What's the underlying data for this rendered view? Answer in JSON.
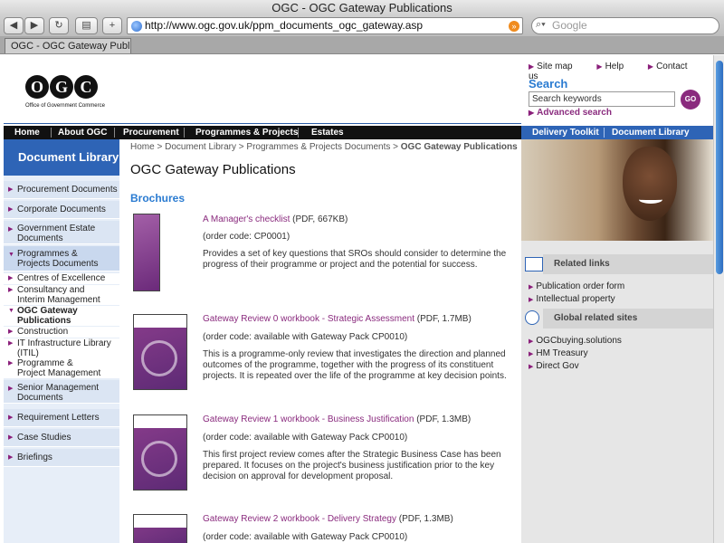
{
  "window": {
    "title": "OGC - OGC Gateway Publications"
  },
  "browser": {
    "back_label": "◀",
    "forward_label": "▶",
    "reload_label": "↻",
    "add_label": "+",
    "url": "http://www.ogc.gov.uk/ppm_documents_ogc_gateway.asp",
    "search_placeholder": "Google",
    "tab_label": "OGC - OGC Gateway Public..."
  },
  "header": {
    "logo_letters": [
      "O",
      "G",
      "C"
    ],
    "logo_tagline": "Office of Government Commerce",
    "util_links": [
      "Site map",
      "Help",
      "Contact us"
    ],
    "search_title": "Search",
    "search_placeholder": "Search keywords",
    "go_label": "GO",
    "advanced_search": "Advanced search"
  },
  "main_nav": [
    "Home",
    "About OGC",
    "Procurement",
    "Programmes & Projects",
    "Estates"
  ],
  "side_nav": [
    "Delivery Toolkit",
    "Document Library"
  ],
  "left_nav": {
    "title": "Document Library",
    "items": [
      "Procurement Documents",
      "Corporate Documents",
      "Government Estate Documents",
      "Programmes & Projects Documents",
      "Centres of Excellence",
      "Consultancy and Interim Management Support",
      "OGC Gateway Publications",
      "Construction",
      "IT Infrastructure Library (ITIL)",
      "Programme & Project Management",
      "Senior Management Documents",
      "Requirement Letters",
      "Case Studies",
      "Briefings"
    ]
  },
  "breadcrumb": {
    "items": [
      "Home",
      "Document Library",
      "Programmes & Projects Documents"
    ],
    "current": "OGC Gateway Publications"
  },
  "page": {
    "title": "OGC Gateway Publications",
    "section": "Brochures"
  },
  "publications": [
    {
      "link": "A Manager's checklist",
      "meta": " (PDF, 667KB)",
      "code": "(order code: CP0001)",
      "desc": "Provides a set of key questions that SROs should consider to determine the progress of their programme or project and the potential for success."
    },
    {
      "link": "Gateway Review 0 workbook - Strategic Assessment",
      "meta": " (PDF, 1.7MB)",
      "code": "(order code: available with Gateway Pack CP0010)",
      "desc": "This is a programme-only review that investigates the direction and planned outcomes of the programme, together with the progress of its constituent projects. It is repeated over the life of the programme at key decision points."
    },
    {
      "link": "Gateway Review 1 workbook - Business Justification",
      "meta": " (PDF, 1.3MB)",
      "code": "(order code: available with Gateway Pack CP0010)",
      "desc": "This first project review comes after the Strategic Business Case has been prepared. It focuses on the project's business justification prior to the key decision on approval for development proposal."
    },
    {
      "link": "Gateway Review 2 workbook - Delivery Strategy",
      "meta": " (PDF, 1.3MB)",
      "code": "(order code: available with Gateway Pack CP0010)",
      "desc": ""
    }
  ],
  "right": {
    "related_links_title": "Related links",
    "related_links": [
      "Publication order form",
      "Intellectual property"
    ],
    "global_sites_title": "Global related sites",
    "global_sites": [
      "OGCbuying.solutions",
      "HM Treasury",
      "Direct Gov"
    ]
  },
  "colors": {
    "brand_blue": "#2e64b6",
    "link_purple": "#8a2b7e",
    "heading_blue": "#2a7bd1",
    "nav_black": "#111111"
  }
}
